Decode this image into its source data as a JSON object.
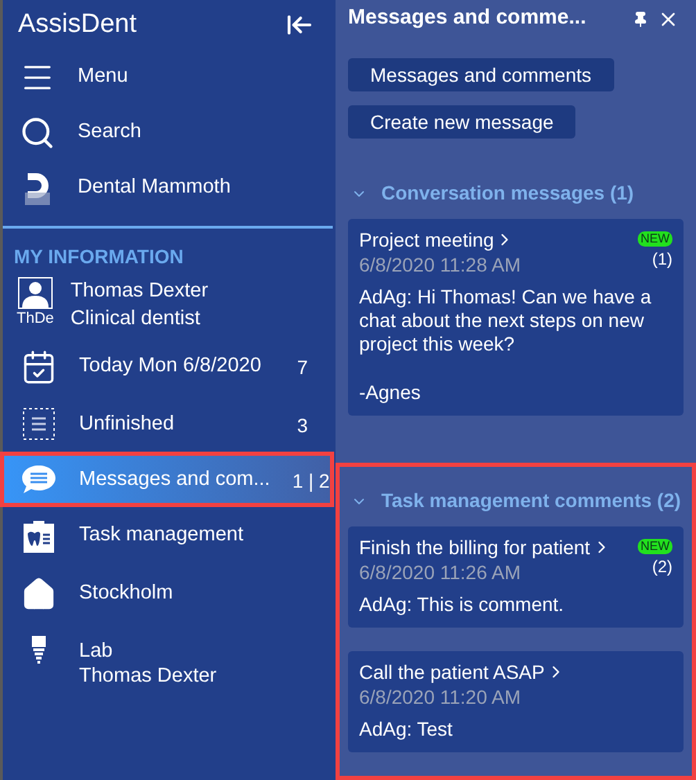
{
  "app": {
    "title": "AssisDent"
  },
  "sidebar": {
    "top_items": [
      {
        "kind": "menu",
        "label": "Menu"
      },
      {
        "kind": "search",
        "label": "Search"
      },
      {
        "kind": "logo",
        "label": "Dental Mammoth"
      }
    ],
    "section_heading": "MY INFORMATION",
    "user": {
      "initials": "ThDe",
      "name": "Thomas Dexter",
      "role": "Clinical dentist"
    },
    "items": [
      {
        "kind": "calendar",
        "label": "Today Mon 6/8/2020",
        "count": "7",
        "selected": false,
        "highlighted": false
      },
      {
        "kind": "unfinished",
        "label": "Unfinished",
        "count": "3",
        "selected": false,
        "highlighted": false
      },
      {
        "kind": "messages",
        "label": "Messages and com...",
        "count": "1 | 2",
        "selected": true,
        "highlighted": true
      },
      {
        "kind": "task",
        "label": "Task management",
        "selected": false,
        "highlighted": false
      },
      {
        "kind": "home",
        "label": "Stockholm",
        "selected": false,
        "highlighted": false
      },
      {
        "kind": "lab",
        "label": "Lab",
        "sublabel": "Thomas Dexter",
        "selected": false,
        "highlighted": false
      }
    ]
  },
  "panel": {
    "title": "Messages and comme...",
    "buttons": [
      "Messages and comments",
      "Create new message"
    ],
    "sections": [
      {
        "title": "Conversation messages (1)",
        "expanded": true,
        "highlighted": false,
        "cards": [
          {
            "title": "Project meeting",
            "time": "6/8/2020 11:28 AM",
            "badge": "NEW",
            "count": "(1)",
            "body": [
              "AdAg: Hi Thomas! Can we have a chat about the next steps on new project this week?",
              "-Agnes"
            ]
          }
        ]
      },
      {
        "title": "Task management comments (2)",
        "expanded": true,
        "highlighted": true,
        "cards": [
          {
            "title": "Finish the billing for patient",
            "time": "6/8/2020 11:26 AM",
            "badge": "NEW",
            "count": "(2)",
            "body": [
              "AdAg: This is comment."
            ]
          },
          {
            "title": "Call the patient ASAP",
            "time": "6/8/2020 11:20 AM",
            "body": [
              "AdAg: Test"
            ]
          }
        ]
      }
    ]
  }
}
